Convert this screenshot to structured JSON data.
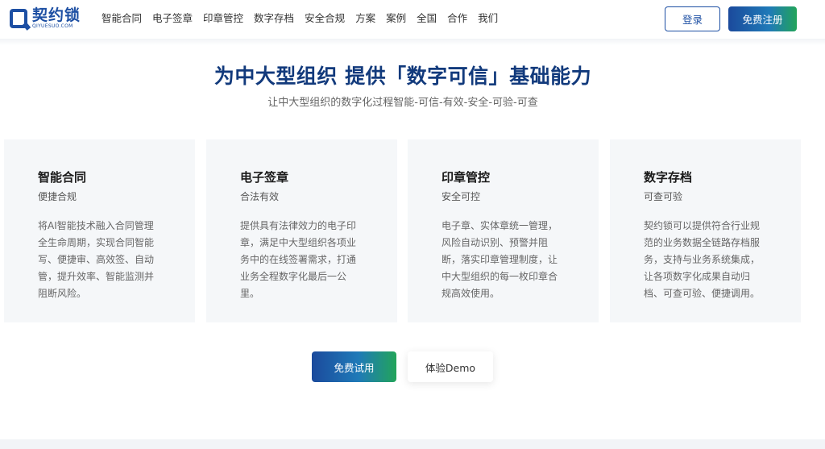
{
  "header": {
    "logo_cn": "契约锁",
    "logo_en": "QIYUESUO.COM",
    "nav": [
      "智能合同",
      "电子签章",
      "印章管控",
      "数字存档",
      "安全合规",
      "方案",
      "案例",
      "全国",
      "合作",
      "我们"
    ],
    "login_label": "登录",
    "register_label": "免费注册"
  },
  "hero": {
    "title": "为中大型组织 提供「数字可信」基础能力",
    "subtitle": "让中大型组织的数字化过程智能-可信-有效-安全-可验-可查"
  },
  "cards": [
    {
      "title": "智能合同",
      "subtitle": "便捷合规",
      "desc": "将AI智能技术融入合同管理全生命周期，实现合同智能写、便捷审、高效签、自动管，提升效率、智能监测并阻断风险。"
    },
    {
      "title": "电子签章",
      "subtitle": "合法有效",
      "desc": "提供具有法律效力的电子印章，满足中大型组织各项业务中的在线签署需求，打通业务全程数字化最后一公里。"
    },
    {
      "title": "印章管控",
      "subtitle": "安全可控",
      "desc": "电子章、实体章统一管理，风险自动识别、预警并阻断，落实印章管理制度，让中大型组织的每一枚印章合规高效使用。"
    },
    {
      "title": "数字存档",
      "subtitle": "可查可验",
      "desc": "契约锁可以提供符合行业规范的业务数据全链路存档服务，支持与业务系统集成，让各项数字化成果自动归档、可查可验、便捷调用。"
    }
  ],
  "cta": {
    "trial_label": "免费试用",
    "demo_label": "体验Demo"
  },
  "colors": {
    "brand": "#1d4fa3",
    "title": "#123a7c",
    "gradient_start": "#1b4a9c",
    "gradient_end": "#22a45a",
    "card_bg": "#f5f7f9"
  }
}
